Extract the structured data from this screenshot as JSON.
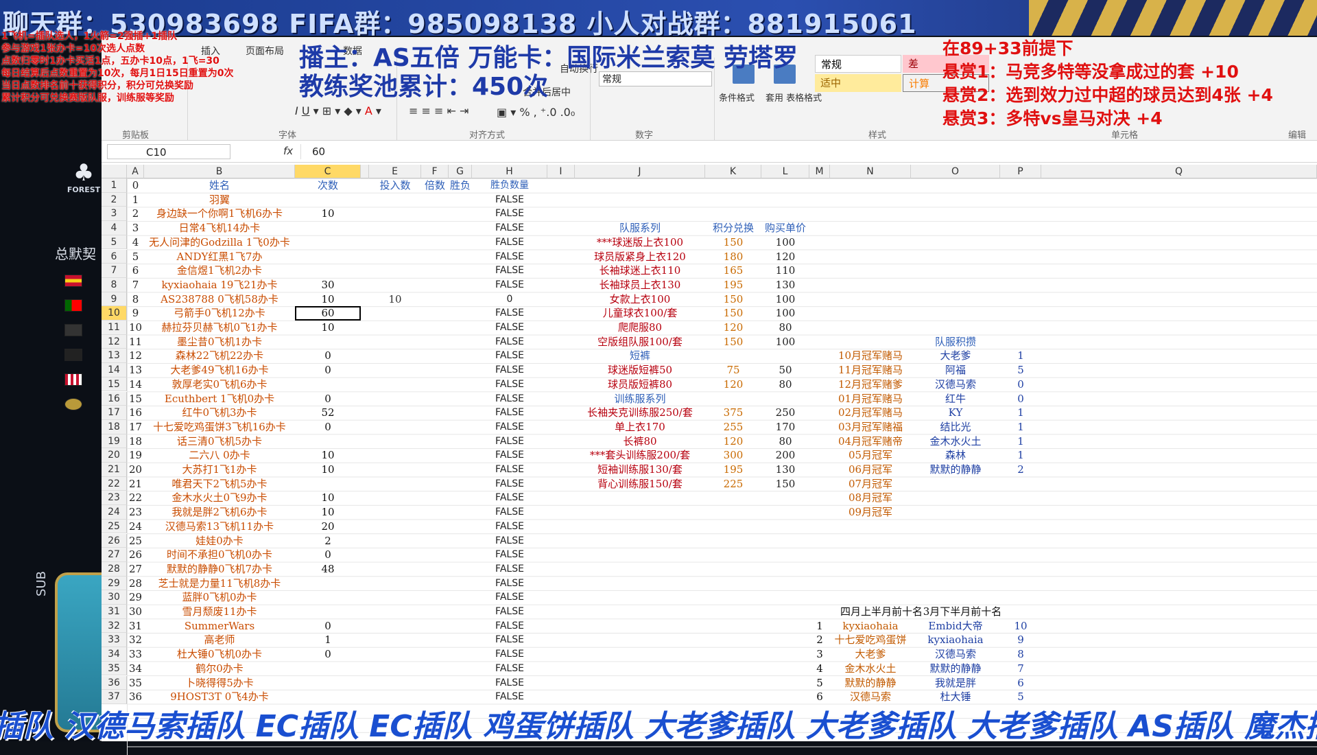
{
  "banner": {
    "text": "聊天群：530983698   FIFA群：985098138   小人对战群：8819150​61"
  },
  "overlay_left": [
    "1飞机=插队选人，1火箭=2强插+1插队",
    "参与游戏1张办卡=10次选人点数",
    "点数归零时1办卡买活1点，五办卡10点，1飞=30",
    "每日结算后点数重置为10次，每月1日15日重置为0次",
    "当日点数排名前十获得积分，积分可兑换奖励",
    "累计积分可兑换赛版队服，训练服等奖励"
  ],
  "overlay_title": [
    "播主：AS五倍 万能卡：国际米兰索莫 劳塔罗",
    "教练奖池累计：450次"
  ],
  "overlay_right": [
    "在89+33前提下",
    "悬赏1：马竞多特等没拿成过的套 +10",
    "悬赏2：选到效力过中超的球员达到4张 +4",
    "悬赏3：多特vs皇马对决 +4"
  ],
  "left_panel": {
    "logo_text": "FOREST",
    "total_label": "总默契",
    "sub_label": "SUB"
  },
  "ribbon": {
    "tabs": [
      "插入",
      "页面布局",
      "数据"
    ],
    "groups": [
      "剪贴板",
      "字体",
      "对齐方式",
      "数字",
      "样式",
      "单元格",
      "编辑"
    ],
    "wrap_text": "自动换行",
    "merge_center": "合并后居中",
    "number_format": "常规",
    "styles": {
      "normal": "常规",
      "bad": "差",
      "neutral": "适中",
      "calc": "计算"
    },
    "cond_format": "条件格式",
    "table_format": "套用\n表格格式"
  },
  "formula_bar": {
    "name_box": "C10",
    "fx": "fx",
    "value": "60"
  },
  "columns": [
    "A",
    "B",
    "C",
    "",
    "E",
    "F",
    "G",
    "H",
    "I",
    "J",
    "K",
    "L",
    "M",
    "N",
    "O",
    "P",
    "Q"
  ],
  "rows": [
    {
      "n": "1",
      "A": "0",
      "B": "姓名",
      "C": "次数",
      "E": "投入数",
      "F": "倍数",
      "G": "胜负",
      "H": "胜负数量",
      "header": true
    },
    {
      "n": "2",
      "A": "1",
      "B": "羽翼",
      "H": "FALSE"
    },
    {
      "n": "3",
      "A": "2",
      "B": "身边缺一个你啊1飞机6办卡",
      "C": "10",
      "H": "FALSE"
    },
    {
      "n": "4",
      "A": "3",
      "B": "日常4飞机14办卡",
      "H": "FALSE",
      "J": "队服系列",
      "K": "积分兑换",
      "L": "购买单价",
      "jhdr": true
    },
    {
      "n": "5",
      "A": "4",
      "B": "无人问津的Godzilla 1飞0办卡",
      "H": "FALSE",
      "J": "***球迷版上衣100",
      "K": "150",
      "L": "100"
    },
    {
      "n": "6",
      "A": "5",
      "B": "ANDY红黑1飞7办",
      "H": "FALSE",
      "J": "球员版紧身上衣120",
      "K": "180",
      "L": "120"
    },
    {
      "n": "7",
      "A": "6",
      "B": "金信煜1飞机2办卡",
      "H": "FALSE",
      "J": "长袖球迷上衣110",
      "K": "165",
      "L": "110"
    },
    {
      "n": "8",
      "A": "7",
      "B": "kyxiaohaia 19飞21办卡",
      "C": "30",
      "H": "FALSE",
      "J": "长袖球员上衣130",
      "K": "195",
      "L": "130"
    },
    {
      "n": "9",
      "A": "8",
      "B": "AS238788 0飞机58办卡",
      "C": "10",
      "E": "10",
      "H": "0",
      "J": "女款上衣100",
      "K": "150",
      "L": "100"
    },
    {
      "n": "10",
      "A": "9",
      "B": "弓箭手0飞机12办卡",
      "C": "60",
      "H": "FALSE",
      "J": "儿童球衣100/套",
      "K": "150",
      "L": "100",
      "active": true
    },
    {
      "n": "11",
      "A": "10",
      "B": "赫拉芬贝赫飞机0飞1办卡",
      "C": "10",
      "H": "FALSE",
      "J": "爬爬服80",
      "K": "120",
      "L": "80"
    },
    {
      "n": "12",
      "A": "11",
      "B": "墨尘昔0飞机1办卡",
      "H": "FALSE",
      "J": "空版组队服100/套",
      "K": "150",
      "L": "100",
      "O": "队服积攒",
      "ohdr": true
    },
    {
      "n": "13",
      "A": "12",
      "B": "森林22飞机22办卡",
      "C": "0",
      "H": "FALSE",
      "J": "短裤",
      "N": "10月冠军赌马",
      "O": "大老爹",
      "P": "1",
      "jhdr": true
    },
    {
      "n": "14",
      "A": "13",
      "B": "大老爹49飞机16办卡",
      "C": "0",
      "H": "FALSE",
      "J": "球迷版短裤50",
      "K": "75",
      "L": "50",
      "N": "11月冠军赌马",
      "O": "阿福",
      "P": "5"
    },
    {
      "n": "15",
      "A": "14",
      "B": "敦厚老实0飞机6办卡",
      "H": "FALSE",
      "J": "球员版短裤80",
      "K": "120",
      "L": "80",
      "N": "12月冠军赌爹",
      "O": "汉德马索",
      "P": "0"
    },
    {
      "n": "16",
      "A": "15",
      "B": "Ecuthbert 1飞机0办卡",
      "C": "0",
      "H": "FALSE",
      "J": "训练服系列",
      "N": "01月冠军赌马",
      "O": "红牛",
      "P": "0",
      "jhdr": true
    },
    {
      "n": "17",
      "A": "16",
      "B": "红牛0飞机3办卡",
      "C": "52",
      "H": "FALSE",
      "J": "长袖夹克训练服250/套",
      "K": "375",
      "L": "250",
      "N": "02月冠军赌马",
      "O": "KY",
      "P": "1"
    },
    {
      "n": "18",
      "A": "17",
      "B": "十七爱吃鸡蛋饼3飞机16办卡",
      "C": "0",
      "H": "FALSE",
      "J": "单上衣170",
      "K": "255",
      "L": "170",
      "N": "03月冠军赌福",
      "O": "结比光",
      "P": "1"
    },
    {
      "n": "19",
      "A": "18",
      "B": "话三清0飞机5办卡",
      "H": "FALSE",
      "J": "长裤80",
      "K": "120",
      "L": "80",
      "N": "04月冠军赌帝",
      "O": "金木水火土",
      "P": "1"
    },
    {
      "n": "20",
      "A": "19",
      "B": "二六八 0办卡",
      "C": "10",
      "H": "FALSE",
      "J": "***套头训练服200/套",
      "K": "300",
      "L": "200",
      "N": "05月冠军",
      "O": "森林",
      "P": "1"
    },
    {
      "n": "21",
      "A": "20",
      "B": "大苏打1飞1办卡",
      "C": "10",
      "H": "FALSE",
      "J": "短袖训练服130/套",
      "K": "195",
      "L": "130",
      "N": "06月冠军",
      "O": "默默的静静",
      "P": "2"
    },
    {
      "n": "22",
      "A": "21",
      "B": "唯君天下2飞机5办卡",
      "H": "FALSE",
      "J": "背心训练服150/套",
      "K": "225",
      "L": "150",
      "N": "07月冠军"
    },
    {
      "n": "23",
      "A": "22",
      "B": "金木水火土0飞9办卡",
      "C": "10",
      "H": "FALSE",
      "N": "08月冠军"
    },
    {
      "n": "24",
      "A": "23",
      "B": "我就是胖2飞机6办卡",
      "C": "10",
      "H": "FALSE",
      "N": "09月冠军"
    },
    {
      "n": "25",
      "A": "24",
      "B": "汉德马索13飞机11办卡",
      "C": "20",
      "H": "FALSE"
    },
    {
      "n": "26",
      "A": "25",
      "B": "娃娃0办卡",
      "C": "2",
      "H": "FALSE"
    },
    {
      "n": "27",
      "A": "26",
      "B": "时间不承担0飞机0办卡",
      "C": "0",
      "H": "FALSE"
    },
    {
      "n": "28",
      "A": "27",
      "B": "默默的静静0飞机7办卡",
      "C": "48",
      "H": "FALSE"
    },
    {
      "n": "29",
      "A": "28",
      "B": "芝士就是力量11飞机8办卡",
      "H": "FALSE"
    },
    {
      "n": "30",
      "A": "29",
      "B": "蓝胖0飞机0办卡",
      "H": "FALSE"
    },
    {
      "n": "31",
      "A": "30",
      "B": "雪月颓废11办卡",
      "H": "FALSE",
      "N": "四月上半月前十名",
      "O": "3月下半月前十名",
      "nhdr": true
    },
    {
      "n": "32",
      "A": "31",
      "B": "SummerWars",
      "C": "0",
      "H": "FALSE",
      "M": "1",
      "N": "kyxiaohaia",
      "O": "Embid大帝",
      "P": "10"
    },
    {
      "n": "33",
      "A": "32",
      "B": "高老师",
      "C": "1",
      "H": "FALSE",
      "M": "2",
      "N": "十七爱吃鸡蛋饼",
      "O": "kyxiaohaia",
      "P": "9"
    },
    {
      "n": "34",
      "A": "33",
      "B": "杜大锤0飞机0办卡",
      "C": "0",
      "H": "FALSE",
      "M": "3",
      "N": "大老爹",
      "O": "汉德马索",
      "P": "8"
    },
    {
      "n": "35",
      "A": "34",
      "B": "鹤尔0办卡",
      "H": "FALSE",
      "M": "4",
      "N": "金木水火土",
      "O": "默默的静静",
      "P": "7"
    },
    {
      "n": "36",
      "A": "35",
      "B": "卜晓得得5办卡",
      "H": "FALSE",
      "M": "5",
      "N": "默默的静静",
      "O": "我就是胖",
      "P": "6"
    },
    {
      "n": "37",
      "A": "36",
      "B": "9HOST3T 0飞4办卡",
      "H": "FALSE",
      "M": "6",
      "N": "汉德马索",
      "O": "杜大锤",
      "P": "5"
    }
  ],
  "ticker": "插队 汉德马索插队 EC插队 EC插队 鸡蛋饼插队 大老爹插队 大老爹插队 大老爹插队 AS插队 魔杰插"
}
